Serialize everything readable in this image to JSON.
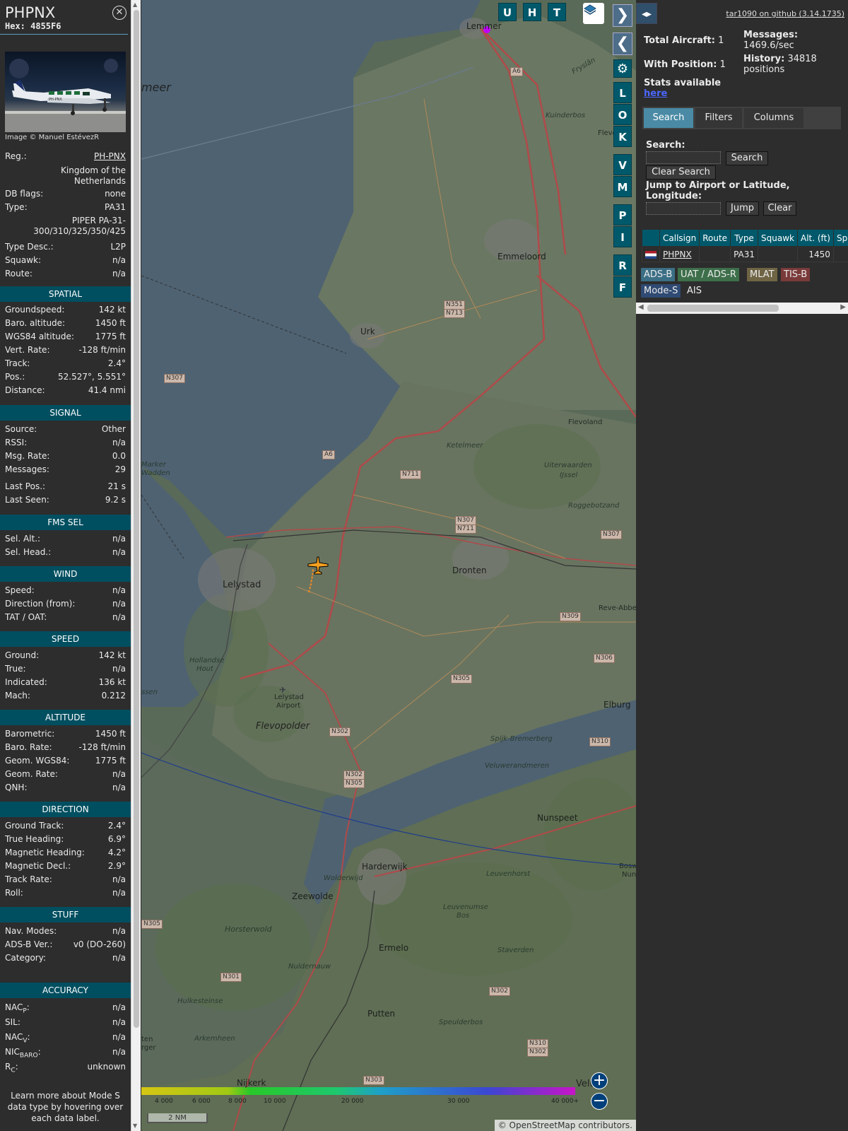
{
  "infobox": {
    "callsign": "PHPNX",
    "hex": "Hex: 4855F6",
    "photo_credit": "Image © Manuel EstévezR",
    "photo_reg": "PH-PNX",
    "reg_label": "Reg.:",
    "reg": "PH-PNX",
    "country": [
      "Kingdom of the",
      "Netherlands"
    ],
    "dbflags_label": "DB flags:",
    "dbflags": "none",
    "type_label": "Type:",
    "type": "PA31",
    "type_full": [
      "PIPER PA-31-",
      "300/310/325/350/425"
    ],
    "typedesc_label": "Type Desc.:",
    "typedesc": "L2P",
    "squawk_label": "Squawk:",
    "squawk": "n/a",
    "route_label": "Route:",
    "route": "n/a",
    "sections": {
      "spatial": "SPATIAL",
      "signal": "SIGNAL",
      "fms": "FMS SEL",
      "wind": "WIND",
      "speed": "SPEED",
      "altitude": "ALTITUDE",
      "direction": "DIRECTION",
      "stuff": "STUFF",
      "accuracy": "ACCURACY"
    },
    "spatial": [
      {
        "k": "Groundspeed:",
        "v": "142 kt"
      },
      {
        "k": "Baro. altitude:",
        "v": "1450 ft"
      },
      {
        "k": "WGS84 altitude:",
        "v": "1775 ft"
      },
      {
        "k": "Vert. Rate:",
        "v": "-128 ft/min"
      },
      {
        "k": "Track:",
        "v": "2.4°"
      },
      {
        "k": "Pos.:",
        "v": "52.527°, 5.551°"
      },
      {
        "k": "Distance:",
        "v": "41.4 nmi"
      }
    ],
    "signal": [
      {
        "k": "Source:",
        "v": "Other"
      },
      {
        "k": "RSSI:",
        "v": "n/a"
      },
      {
        "k": "Msg. Rate:",
        "v": "0.0"
      },
      {
        "k": "Messages:",
        "v": "29"
      },
      {
        "k": "Last Pos.:",
        "v": "21 s"
      },
      {
        "k": "Last Seen:",
        "v": "9.2 s"
      }
    ],
    "fms": [
      {
        "k": "Sel. Alt.:",
        "v": "n/a"
      },
      {
        "k": "Sel. Head.:",
        "v": "n/a"
      }
    ],
    "wind": [
      {
        "k": "Speed:",
        "v": "n/a"
      },
      {
        "k": "Direction (from):",
        "v": "n/a"
      },
      {
        "k": "TAT / OAT:",
        "v": "n/a"
      }
    ],
    "speed": [
      {
        "k": "Ground:",
        "v": "142 kt"
      },
      {
        "k": "True:",
        "v": "n/a"
      },
      {
        "k": "Indicated:",
        "v": "136 kt"
      },
      {
        "k": "Mach:",
        "v": "0.212"
      }
    ],
    "altitude": [
      {
        "k": "Barometric:",
        "v": "1450 ft"
      },
      {
        "k": "Baro. Rate:",
        "v": "-128 ft/min"
      },
      {
        "k": "Geom. WGS84:",
        "v": "1775 ft"
      },
      {
        "k": "Geom. Rate:",
        "v": "n/a"
      },
      {
        "k": "QNH:",
        "v": "n/a"
      }
    ],
    "direction": [
      {
        "k": "Ground Track:",
        "v": "2.4°"
      },
      {
        "k": "True Heading:",
        "v": "6.9°"
      },
      {
        "k": "Magnetic Heading:",
        "v": "4.2°"
      },
      {
        "k": "Magnetic Decl.:",
        "v": "2.9°"
      },
      {
        "k": "Track Rate:",
        "v": "n/a"
      },
      {
        "k": "Roll:",
        "v": "n/a"
      }
    ],
    "stuff": [
      {
        "k": "Nav. Modes:",
        "v": "n/a"
      },
      {
        "k": "ADS-B Ver.:",
        "v": "v0 (DO-260)"
      },
      {
        "k": "Category:",
        "v": "n/a"
      }
    ],
    "accuracy": [
      {
        "k": "NAC",
        "sub": "P",
        "v": "n/a"
      },
      {
        "k": "SIL:",
        "sub": "",
        "v": "n/a"
      },
      {
        "k": "NAC",
        "sub": "V",
        "v": "n/a"
      },
      {
        "k": "NIC",
        "sub": "BARO",
        "v": "n/a"
      },
      {
        "k": "R",
        "sub": "C",
        "v": "unknown"
      }
    ],
    "footer": [
      "Learn more about Mode S",
      "data type by hovering over",
      "each data label."
    ]
  },
  "map": {
    "toolbar_letters": [
      "U",
      "H",
      "T"
    ],
    "side_letters": [
      "L",
      "O",
      "K",
      "V",
      "M",
      "P",
      "I",
      "R",
      "F"
    ],
    "labels": {
      "lemmer": "Lemmer",
      "emmeloord": "Emmeloord",
      "urk": "Urk",
      "lelystad": "Lelystad",
      "dronten": "Dronten",
      "flevopolder": "Flevopolder",
      "elburg": "Elburg",
      "nunspeet": "Nunspeet",
      "harderwijk": "Harderwijk",
      "zeewolde": "Zeewolde",
      "ermelo": "Ermelo",
      "putten": "Putten",
      "nijkerk": "Nijkerk",
      "ketelmeer": "Ketelmeer",
      "veluwerandmeren": "Veluwerandmeren",
      "uiterwaarden": "Uiterwaarden",
      "ijssel": "IJssel",
      "roggebotzand": "Roggebotzand",
      "kuinderbos": "Kuinderbos",
      "flevoland": "Flevoland",
      "reve": "Reve-Abbert",
      "spijk": "Spijk-Bremerberg",
      "leuvenhorst": "Leuvenhorst",
      "leuvenumse": "Leuvenumse",
      "bos": "Bos",
      "staverden": "Staverden",
      "speulderbos": "Speulderbos",
      "horsterwold": "Horsterwold",
      "hollandse": "Hollandse",
      "hout": "Hout",
      "hulkesteinse": "Hulkesteinse",
      "arkemheen": "Arkemheen",
      "nuldernauw": "Nuldernauw",
      "wolderwijd": "Wolderwijd",
      "lelystad_airport": "Lelystad",
      "airport": "Airport",
      "meer": "meer",
      "marker": "Marker",
      "wadden": "Wadden",
      "frysla": "Fryslân",
      "flevoland2": "Flevolan",
      "ssen": "ssen",
      "ten": "ten",
      "rger": "rger",
      "bosw": "Bosw",
      "nun": "Nun",
      "velu": "Velu"
    },
    "shields": [
      "A6",
      "A6",
      "N307",
      "N351",
      "N713",
      "N711",
      "N307",
      "N711",
      "N307",
      "N309",
      "N306",
      "N305",
      "N302",
      "N302",
      "N305",
      "N310",
      "N305",
      "N301",
      "N302",
      "N310",
      "N302",
      "N303"
    ],
    "altitude_scale": [
      "4 000",
      "6 000",
      "8 000",
      "10 000",
      "20 000",
      "30 000",
      "40 000+"
    ],
    "scale": "2 NM",
    "attribution": "© OpenStreetMap contributors."
  },
  "sidebar": {
    "github": "tar1090 on github (3.14.1735)",
    "total_aircraft": "Total Aircraft:",
    "total_aircraft_val": "1",
    "with_position": "With Position:",
    "with_position_val": "1",
    "messages": "Messages:",
    "messages_val": "1469.6/sec",
    "history": "History:",
    "history_val": "34818",
    "history_unit": "positions",
    "stats": "Stats available",
    "stats_link": "here",
    "tabs": [
      "Search",
      "Filters",
      "Columns"
    ],
    "search_label": "Search:",
    "search_btn": "Search",
    "clear_search_btn": "Clear Search",
    "jump_label": [
      "Jump to Airport or Latitude,",
      "Longitude:"
    ],
    "jump_btn": "Jump",
    "clear_btn": "Clear",
    "table_headers": [
      "",
      "Callsign",
      "Route",
      "Type",
      "Squawk",
      "Alt. (ft)",
      "Spd."
    ],
    "table_rows": [
      {
        "callsign": "PHPNX",
        "route": "",
        "type": "PA31",
        "squawk": "",
        "alt": "1450",
        "spd": ""
      }
    ],
    "legend": [
      {
        "label": "ADS-B",
        "color": "#3b6f85"
      },
      {
        "label": "UAT / ADS-R",
        "color": "#3d6f4a"
      },
      {
        "label": "MLAT",
        "color": "#6f6545"
      },
      {
        "label": "TIS-B",
        "color": "#7a3a3a"
      },
      {
        "label": "Mode-S",
        "color": "#2f4a73"
      },
      {
        "label": "AIS",
        "color": "#2d2d2d"
      }
    ]
  },
  "colors": {
    "section_bg": "#004f60",
    "button_bg": "#00596b",
    "active_tab": "#4a8aa5",
    "aircraft": "#f5a020",
    "trail": "#ff8a1e"
  }
}
